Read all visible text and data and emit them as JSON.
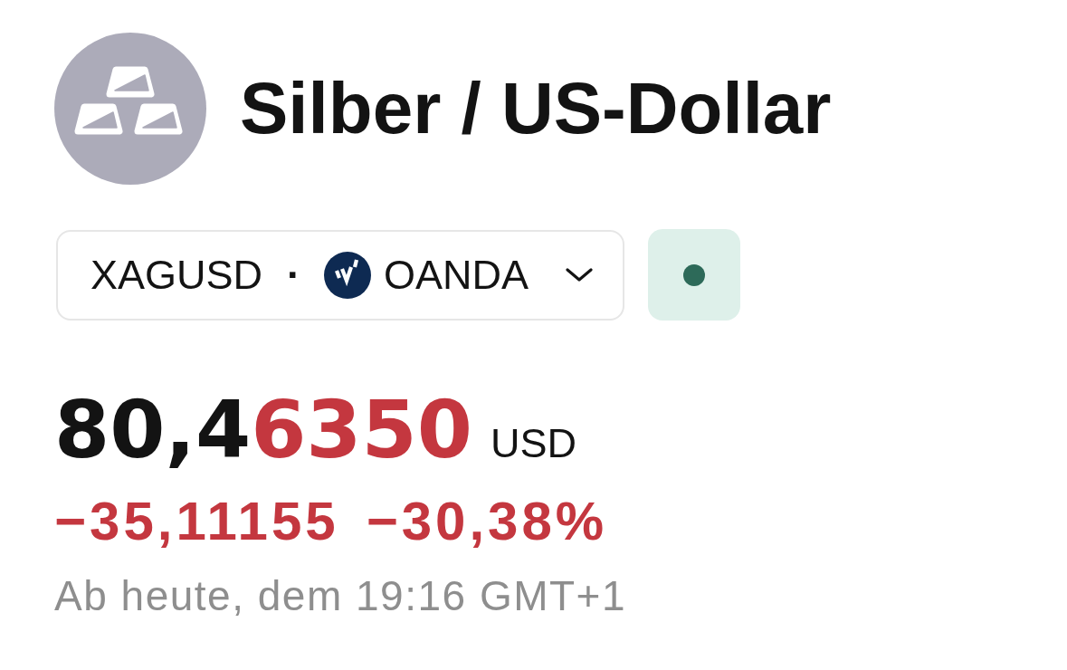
{
  "instrument": {
    "name": "Silber / US-Dollar"
  },
  "symbol_selector": {
    "symbol": "XAGUSD",
    "separator": "·",
    "exchange": "OANDA"
  },
  "market_status": {
    "color": "#2d6a59"
  },
  "price": {
    "leading_digits": "80,4",
    "changed_digits": "6350",
    "falling": true,
    "currency": "USD"
  },
  "change": {
    "falling": true,
    "absolute": "−35,11155",
    "percent": "−30,38%"
  },
  "timestamp": "Ab heute, dem 19:16 GMT+1"
}
